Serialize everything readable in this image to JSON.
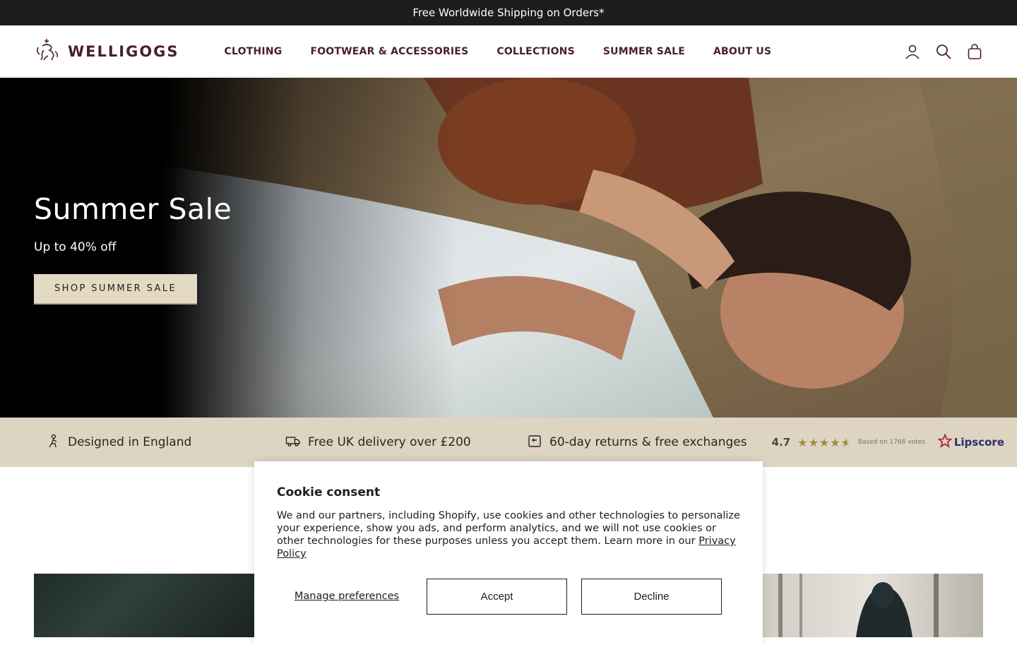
{
  "announcement": "Free Worldwide Shipping on Orders*",
  "brand": {
    "name": "WELLIGOGS"
  },
  "nav": [
    "CLOTHING",
    "FOOTWEAR & ACCESSORIES",
    "COLLECTIONS",
    "SUMMER SALE",
    "ABOUT US"
  ],
  "header_icons": [
    "account-icon",
    "search-icon",
    "bag-icon"
  ],
  "hero": {
    "title": "Summer Sale",
    "subtitle": "Up to 40% off",
    "cta": "SHOP SUMMER SALE"
  },
  "usp": [
    {
      "icon": "figure-icon",
      "label": "Designed in England"
    },
    {
      "icon": "truck-icon",
      "label": "Free UK delivery over £200"
    },
    {
      "icon": "return-icon",
      "label": "60-day returns & free exchanges"
    }
  ],
  "rating": {
    "score": "4.7",
    "stars": 4.7,
    "votes_text": "Based on 1768 votes",
    "provider": "Lipscore"
  },
  "cookie": {
    "title": "Cookie consent",
    "text": "We and our partners, including Shopify, use cookies and other technologies to personalize your experience, show you ads, and perform analytics, and we will not use cookies or other technologies for these purposes unless you accept them. Learn more in our ",
    "link": "Privacy Policy",
    "manage": "Manage preferences",
    "accept": "Accept",
    "decline": "Decline"
  },
  "colors": {
    "brand": "#4a1f2a",
    "announce_bg": "#1d1d1d",
    "usp_bg": "#ded4c2",
    "cta_bg": "#e3d9c5"
  }
}
